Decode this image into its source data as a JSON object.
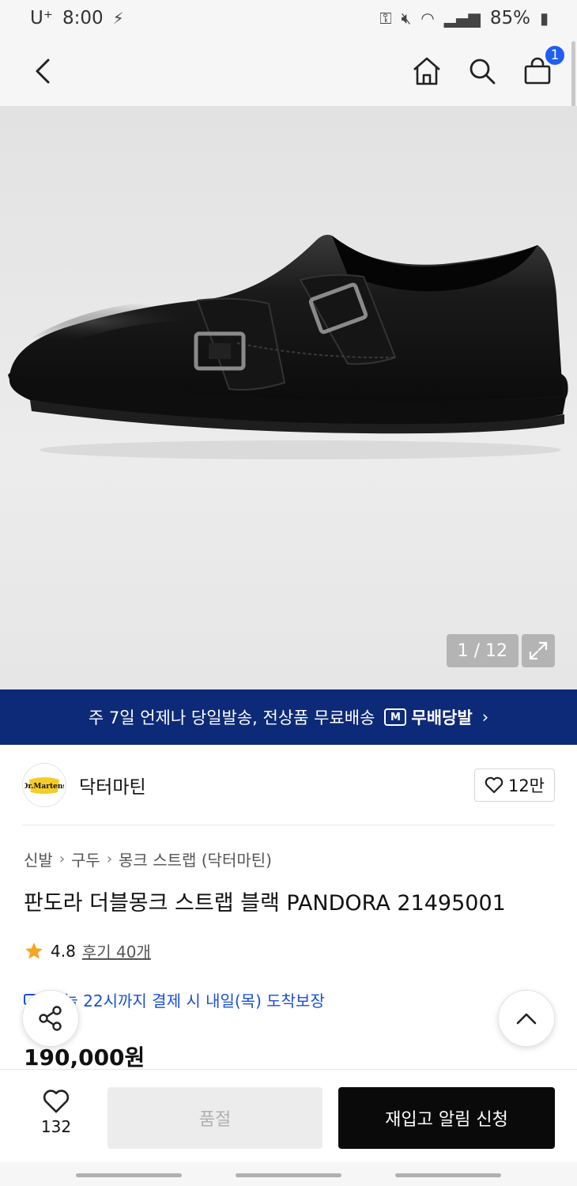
{
  "status_bar": {
    "carrier": "U⁺",
    "time": "8:00",
    "battery": "85%"
  },
  "header": {
    "cart_count": "1"
  },
  "gallery": {
    "counter": "1 / 12"
  },
  "banner": {
    "text": "주 7일 언제나 당일발송, 전상품 무료배송",
    "badge_label": "무배당발",
    "badge_icon": "M",
    "arrow": "›"
  },
  "brand": {
    "logo_text": "Dr.\nMartens",
    "name": "닥터마틴",
    "likes": "12만"
  },
  "product": {
    "breadcrumb": [
      "신발",
      "구두",
      "몽크 스트랩 (닥터마틴)"
    ],
    "title": "판도라 더블몽크 스트랩 블랙 PANDORA 21495001",
    "rating": "4.8",
    "reviews": "후기 40개",
    "delivery": "오늘 22시까지 결제 시 내일(목) 도착보장",
    "price": "190,000원"
  },
  "bottom_bar": {
    "wish_count": "132",
    "soldout_label": "품절",
    "restock_label": "재입고 알림 신청"
  },
  "colors": {
    "accent_blue": "#1e5ef3",
    "banner_navy": "#0d2a78",
    "star": "#f5a623"
  }
}
